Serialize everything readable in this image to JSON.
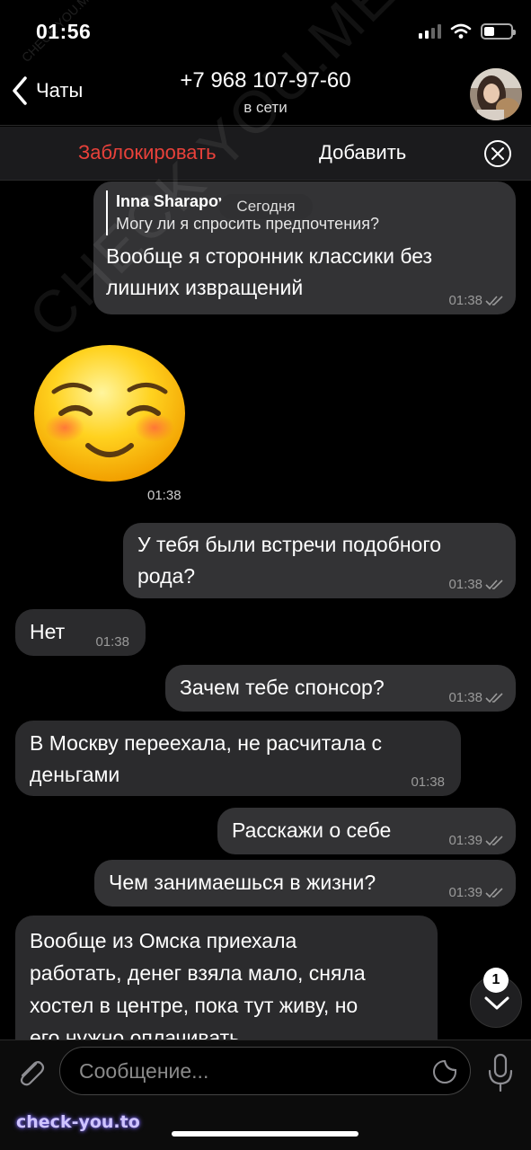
{
  "status_bar": {
    "time": "01:56"
  },
  "header": {
    "back_label": "Чаты",
    "contact_name": "+7 968 107-97-60",
    "contact_status": "в сети"
  },
  "actions": {
    "block_label": "Заблокировать",
    "add_label": "Добавить"
  },
  "chat": {
    "date_label": "Сегодня",
    "messages": [
      {
        "direction": "out",
        "reply_author": "Inna Sharapova",
        "reply_text": "Могу ли я спросить предпочтения?",
        "lines": [
          "Вообще я сторонник классики без",
          "лишних извращений"
        ],
        "time": "01:38",
        "read": true
      },
      {
        "direction": "in",
        "sticker": "smiling-blushing-face-sticker",
        "time": "01:38"
      },
      {
        "direction": "out",
        "lines": [
          "У тебя были встречи подобного",
          "рода?"
        ],
        "time": "01:38",
        "read": true
      },
      {
        "direction": "in",
        "lines": [
          "Нет"
        ],
        "time": "01:38"
      },
      {
        "direction": "out",
        "lines": [
          "Зачем тебе спонсор?"
        ],
        "time": "01:38",
        "read": true
      },
      {
        "direction": "in",
        "lines": [
          "В Москву переехала, не расчитала с",
          "деньгами"
        ],
        "time": "01:38"
      },
      {
        "direction": "out",
        "lines": [
          "Расскажи о себе"
        ],
        "time": "01:39",
        "read": true
      },
      {
        "direction": "out",
        "lines": [
          "Чем занимаешься в жизни?"
        ],
        "time": "01:39",
        "read": true
      },
      {
        "direction": "in",
        "lines": [
          "Вообще из Омска приехала",
          "работать, денег взяла мало, сняла",
          "хостел в центре, пока тут живу, но",
          "его нужно оплачивать"
        ]
      }
    ],
    "unread_count": "1"
  },
  "composer": {
    "placeholder": "Сообщение..."
  },
  "watermarks": {
    "site": "check-you.to",
    "overlay": "CHECK YOU.ME"
  },
  "colors": {
    "background": "#000000",
    "bubble": "#2b2b2d",
    "danger": "#e8413a",
    "text": "#ffffff",
    "meta": "#9a9a9a"
  },
  "icons": [
    "chevron-left-icon",
    "signal-icon",
    "wifi-icon",
    "battery-icon",
    "close-circle-icon",
    "double-check-icon",
    "paperclip-icon",
    "sticker-icon",
    "microphone-icon",
    "chevron-down-icon"
  ]
}
